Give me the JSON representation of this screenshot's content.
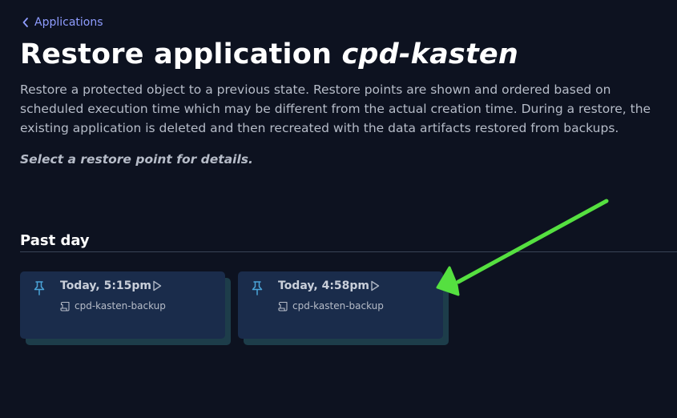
{
  "breadcrumb": {
    "label": "Applications",
    "icon": "chevron-left-icon"
  },
  "header": {
    "title_prefix": "Restore application",
    "app_name": "cpd-kasten"
  },
  "description": "Restore a protected object to a previous state. Restore points are shown and ordered based on scheduled execution time which may be different from the actual creation time. During a restore, the existing application is deleted and then recreated with the data artifacts restored from backups.",
  "hint": "Select a restore point for details.",
  "section": {
    "title": "Past day",
    "restore_points": [
      {
        "time": "Today, 5:15pm",
        "policy": "cpd-kasten-backup",
        "icon": "pin-icon",
        "action_icon": "play-icon",
        "policy_icon": "scroll-icon"
      },
      {
        "time": "Today, 4:58pm",
        "policy": "cpd-kasten-backup",
        "icon": "pin-icon",
        "action_icon": "play-icon",
        "policy_icon": "scroll-icon"
      }
    ]
  },
  "colors": {
    "background": "#0d1220",
    "link": "#8f9dff",
    "card": "#1a2c4b",
    "card_shadow": "#1d3d4a",
    "pin_icon": "#4aa3d8",
    "annotation_arrow": "#55e040"
  }
}
